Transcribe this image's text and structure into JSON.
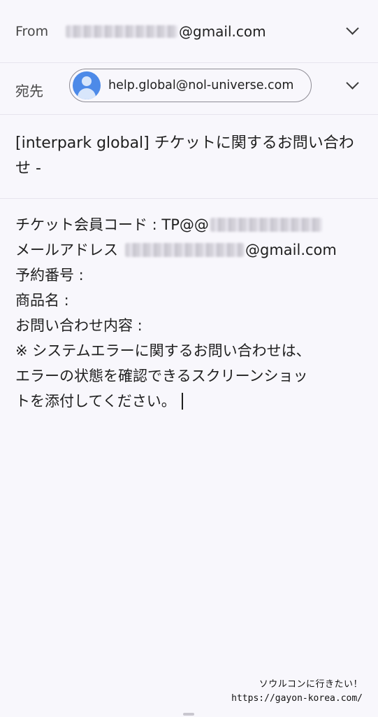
{
  "header": {
    "from_label": "From",
    "from_email_domain": "@gmail.com",
    "to_label": "宛先",
    "recipient_email": "help.global@nol-universe.com"
  },
  "subject": "[interpark global] チケットに関するお問い合わせ -",
  "body": {
    "member_code_label": "チケット会員コード : TP@@",
    "email_label": "メールアドレス",
    "email_domain": "@gmail.com",
    "reservation_label": "予約番号 :",
    "product_label": "商品名 :",
    "inquiry_label": "お問い合わせ内容 :",
    "note_line1": "※ システムエラーに関するお問い合わせは、",
    "note_line2": "エラーの状態を確認できるスクリーンショッ",
    "note_line3": "トを添付してください。"
  },
  "watermark": {
    "line1": "ソウルコンに行きたい！",
    "line2": "https://gayon-korea.com/"
  },
  "icons": {
    "avatar": "person-avatar-icon",
    "expand": "chevron-down-icon"
  },
  "colors": {
    "background": "#f8f7fc",
    "avatar": "#4d8ae8",
    "divider": "#e7e5ee"
  }
}
